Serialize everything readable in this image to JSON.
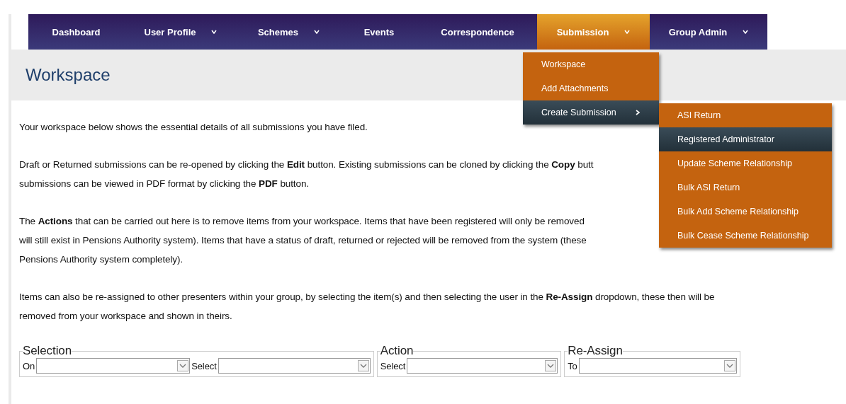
{
  "nav": [
    {
      "label": "Dashboard",
      "caret": false,
      "selected": false
    },
    {
      "label": "User Profile",
      "caret": true,
      "selected": false
    },
    {
      "label": "Schemes",
      "caret": true,
      "selected": false
    },
    {
      "label": "Events",
      "caret": false,
      "selected": false
    },
    {
      "label": "Correspondence",
      "caret": false,
      "selected": false
    },
    {
      "label": "Submission",
      "caret": true,
      "selected": true
    },
    {
      "label": "Group Admin",
      "caret": true,
      "selected": false
    }
  ],
  "title": "Workspace",
  "dropdown": {
    "items": [
      {
        "label": "Workspace",
        "submenu": false,
        "selected": false
      },
      {
        "label": "Add Attachments",
        "submenu": false,
        "selected": false
      },
      {
        "label": "Create Submission",
        "submenu": true,
        "selected": true
      }
    ],
    "submenu": [
      {
        "label": "ASI Return",
        "selected": false
      },
      {
        "label": "Registered Administrator",
        "selected": true
      },
      {
        "label": "Update Scheme Relationship",
        "selected": false
      },
      {
        "label": "Bulk ASI Return",
        "selected": false
      },
      {
        "label": "Bulk Add Scheme Relationship",
        "selected": false
      },
      {
        "label": "Bulk Cease Scheme Relationship",
        "selected": false
      }
    ]
  },
  "paragraphs": [
    [
      "Your workspace below shows the essential details of all submissions you have filed."
    ],
    [
      "Draft or Returned submissions can be re-opened by clicking the **Edit** button. Existing submissions can be cloned by clicking the **Copy** butt",
      "submissions can be viewed in PDF format by clicking the **PDF** button."
    ],
    [
      "The **Actions** that can be carried out here is to remove items from your workspace. Items that have been registered will only be removed",
      "will still exist in Pensions Authority system). Items that have a status of draft, returned or rejected will be removed from the system (these",
      "Pensions Authority system completely)."
    ],
    [
      "Items can also be re-assigned to other presenters within your group, by selecting the item(s) and then selecting the user in the **Re-Assign** dropdown, these then will be",
      "removed from your workspace and shown in theirs."
    ]
  ],
  "filters": [
    {
      "legend": "Selection",
      "fields": [
        {
          "label": "On"
        },
        {
          "label": "Select"
        }
      ]
    },
    {
      "legend": "Action",
      "fields": [
        {
          "label": "Select"
        }
      ]
    },
    {
      "legend": "Re-Assign",
      "fields": [
        {
          "label": "To"
        }
      ]
    }
  ]
}
